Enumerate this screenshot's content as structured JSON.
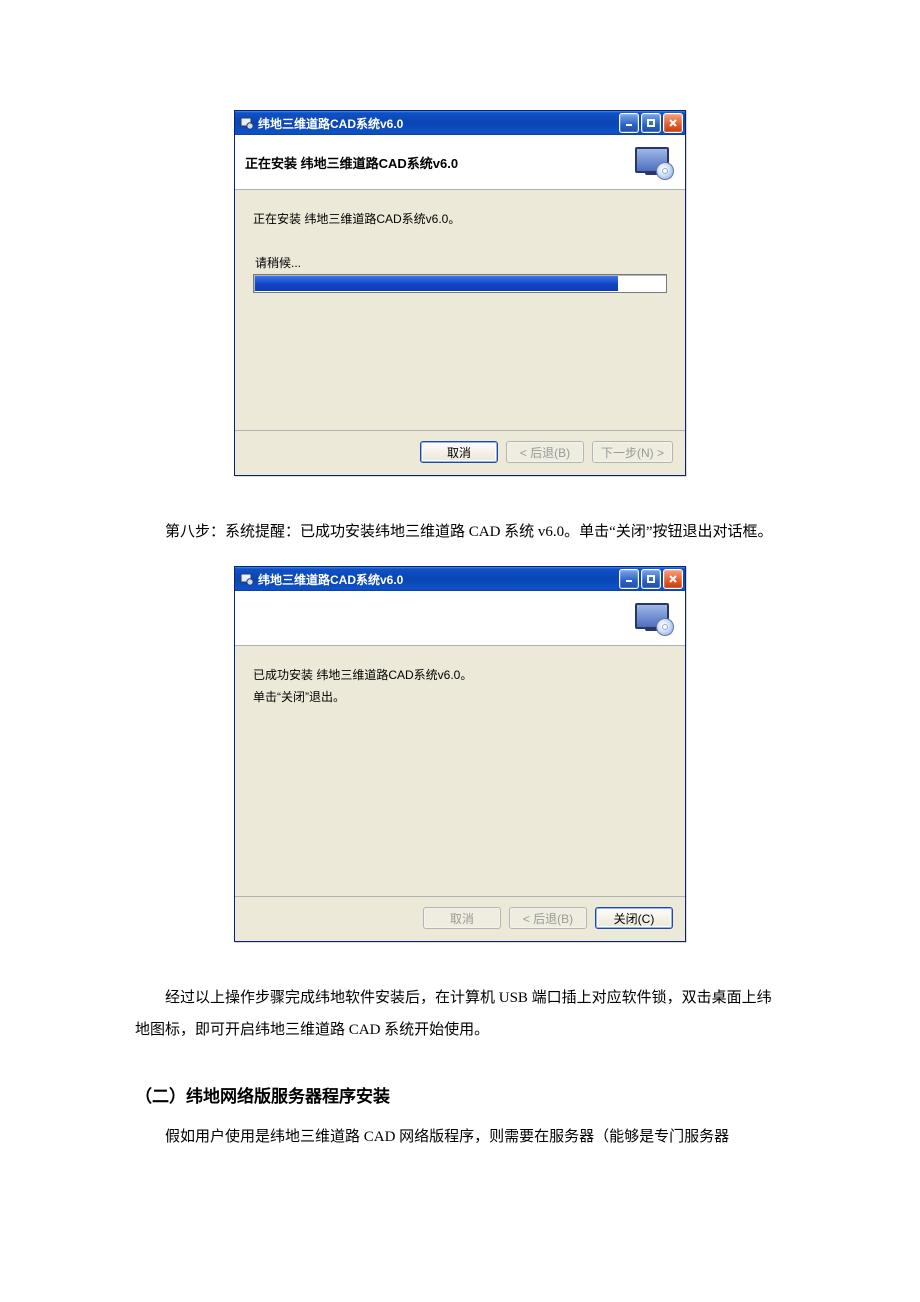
{
  "dialog1": {
    "window_title": "纬地三维道路CAD系统v6.0",
    "header_title": "正在安装 纬地三维道路CAD系统v6.0",
    "body_text": "正在安装 纬地三维道路CAD系统v6.0。",
    "wait_label": "请稍候...",
    "progress_percent": 88,
    "buttons": {
      "cancel": "取消",
      "back": "< 后退(B)",
      "next": "下一步(N) >"
    }
  },
  "para_step8": "第八步：系统提醒：已成功安装纬地三维道路 CAD 系统 v6.0。单击“关闭”按钮退出对话框。",
  "dialog2": {
    "window_title": "纬地三维道路CAD系统v6.0",
    "body_line1": "已成功安装 纬地三维道路CAD系统v6.0。",
    "body_line2": "单击“关闭”退出。",
    "buttons": {
      "cancel": "取消",
      "back": "< 后退(B)",
      "close": "关闭(C)"
    }
  },
  "para_after": "经过以上操作步骤完成纬地软件安装后，在计算机 USB 端口插上对应软件锁，双击桌面上纬地图标，即可开启纬地三维道路 CAD 系统开始使用。",
  "heading_section2": "（二）纬地网络版服务器程序安装",
  "para_section2": "假如用户使用是纬地三维道路 CAD 网络版程序，则需要在服务器（能够是专门服务器"
}
